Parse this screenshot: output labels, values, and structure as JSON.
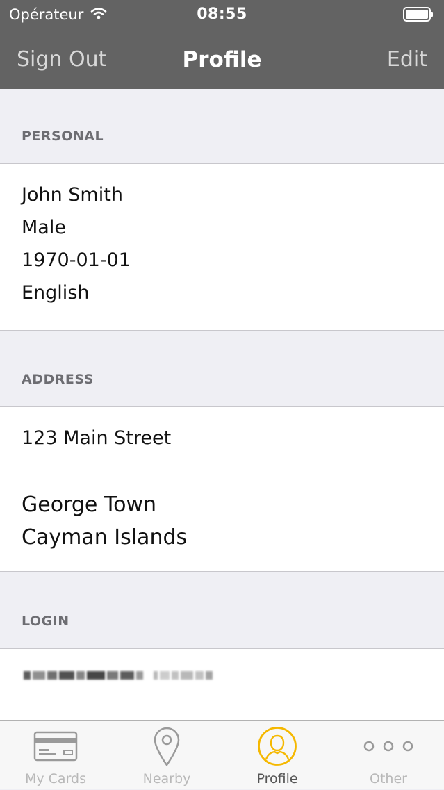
{
  "status_bar": {
    "carrier": "Opérateur",
    "time": "08:55"
  },
  "nav": {
    "left_label": "Sign Out",
    "title": "Profile",
    "right_label": "Edit"
  },
  "sections": {
    "personal": {
      "header": "PERSONAL",
      "name": "John Smith",
      "gender": "Male",
      "birthdate": "1970-01-01",
      "language": "English"
    },
    "address": {
      "header": "ADDRESS",
      "street": "123 Main Street",
      "city": "George Town",
      "country": "Cayman Islands"
    },
    "login": {
      "header": "LOGIN"
    }
  },
  "tabs": [
    {
      "label": "My Cards",
      "icon": "credit-card-icon",
      "active": false
    },
    {
      "label": "Nearby",
      "icon": "map-pin-icon",
      "active": false
    },
    {
      "label": "Profile",
      "icon": "user-icon",
      "active": true
    },
    {
      "label": "Other",
      "icon": "more-icon",
      "active": false
    }
  ],
  "colors": {
    "header_bg": "#636363",
    "accent": "#f5b800",
    "list_bg": "#efeff4"
  }
}
